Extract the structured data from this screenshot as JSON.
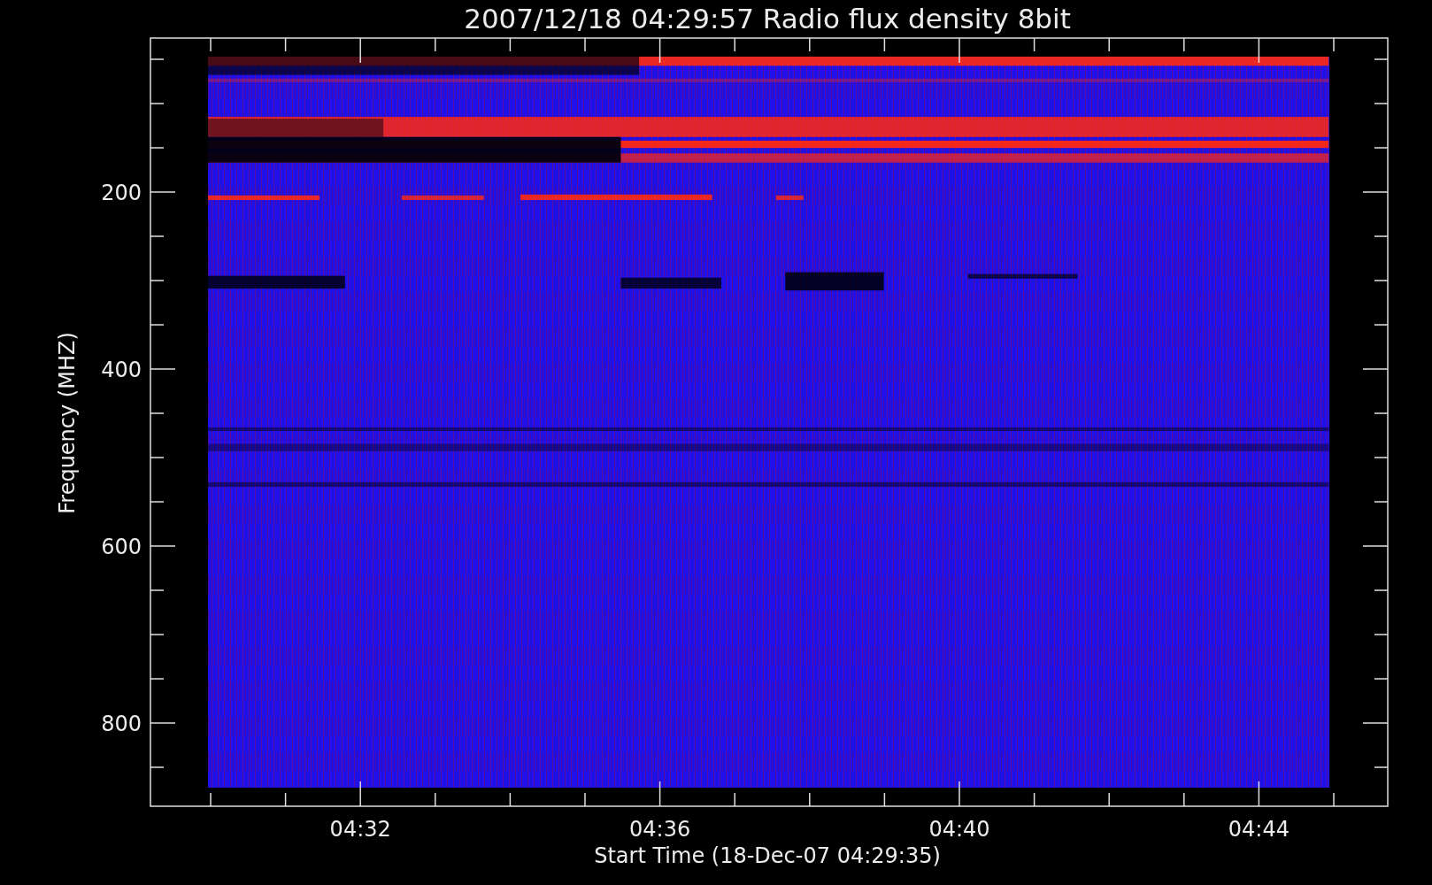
{
  "title": "2007/12/18 04:29:57 Radio flux density 8bit",
  "y_axis": {
    "label": "Frequency (MHZ)",
    "ticks": [
      "200",
      "400",
      "600",
      "800"
    ]
  },
  "x_axis": {
    "label": "Start Time (18-Dec-07 04:29:35)",
    "ticks": [
      "04:32",
      "04:36",
      "04:40",
      "04:44"
    ]
  }
}
